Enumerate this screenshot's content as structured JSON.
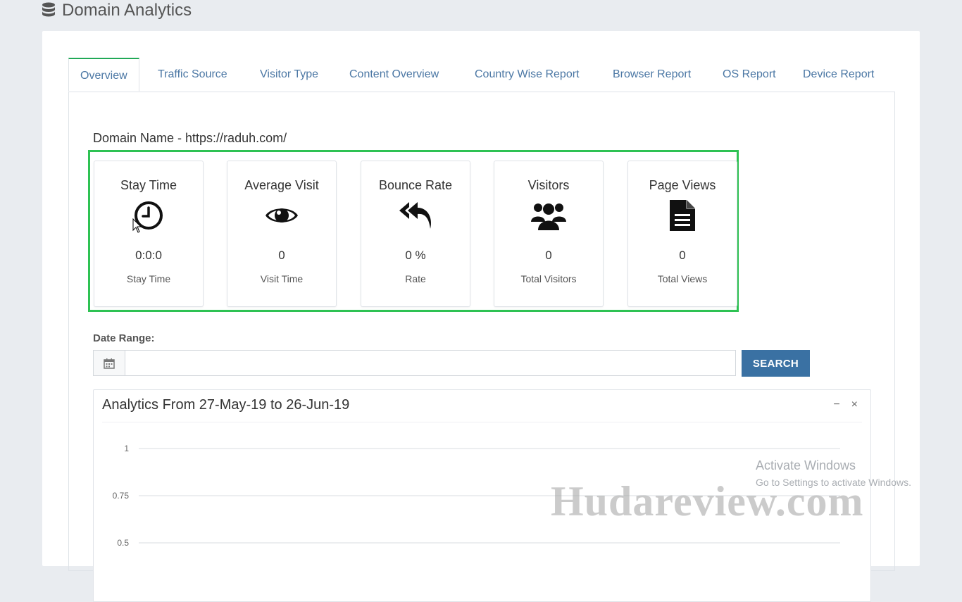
{
  "header": {
    "title": "Domain Analytics"
  },
  "tabs": [
    {
      "label": "Overview",
      "active": true
    },
    {
      "label": "Traffic Source"
    },
    {
      "label": "Visitor Type"
    },
    {
      "label": "Content Overview"
    },
    {
      "label": "Country Wise Report"
    },
    {
      "label": "Browser Report"
    },
    {
      "label": "OS Report"
    },
    {
      "label": "Device Report"
    }
  ],
  "domain": {
    "label": "Domain Name - https://raduh.com/"
  },
  "stats": [
    {
      "title": "Stay Time",
      "icon": "clock-icon",
      "value": "0:0:0",
      "sub": "Stay Time"
    },
    {
      "title": "Average Visit",
      "icon": "eye-icon",
      "value": "0",
      "sub": "Visit Time"
    },
    {
      "title": "Bounce Rate",
      "icon": "reply-all-icon",
      "value": "0 %",
      "sub": "Rate"
    },
    {
      "title": "Visitors",
      "icon": "users-icon",
      "value": "0",
      "sub": "Total Visitors"
    },
    {
      "title": "Page Views",
      "icon": "file-icon",
      "value": "0",
      "sub": "Total Views"
    }
  ],
  "date_range": {
    "label": "Date Range:",
    "value": "",
    "placeholder": "",
    "search_label": "SEARCH"
  },
  "panel": {
    "title": "Analytics From 27-May-19 to 26-Jun-19",
    "minimize": "−",
    "close": "×"
  },
  "chart_data": {
    "type": "line",
    "y_ticks": [
      "1",
      "0.75",
      "0.5"
    ],
    "ylim": [
      0,
      1
    ],
    "grid": true,
    "series": []
  },
  "watermark": {
    "activate_title": "Activate Windows",
    "activate_sub": "Go to Settings to activate Windows.",
    "brand": "Hudareview.com"
  },
  "colors": {
    "accent": "#21a957",
    "highlight": "#2ec253",
    "button": "#3a71a3",
    "tab_text": "#4b77a4"
  }
}
